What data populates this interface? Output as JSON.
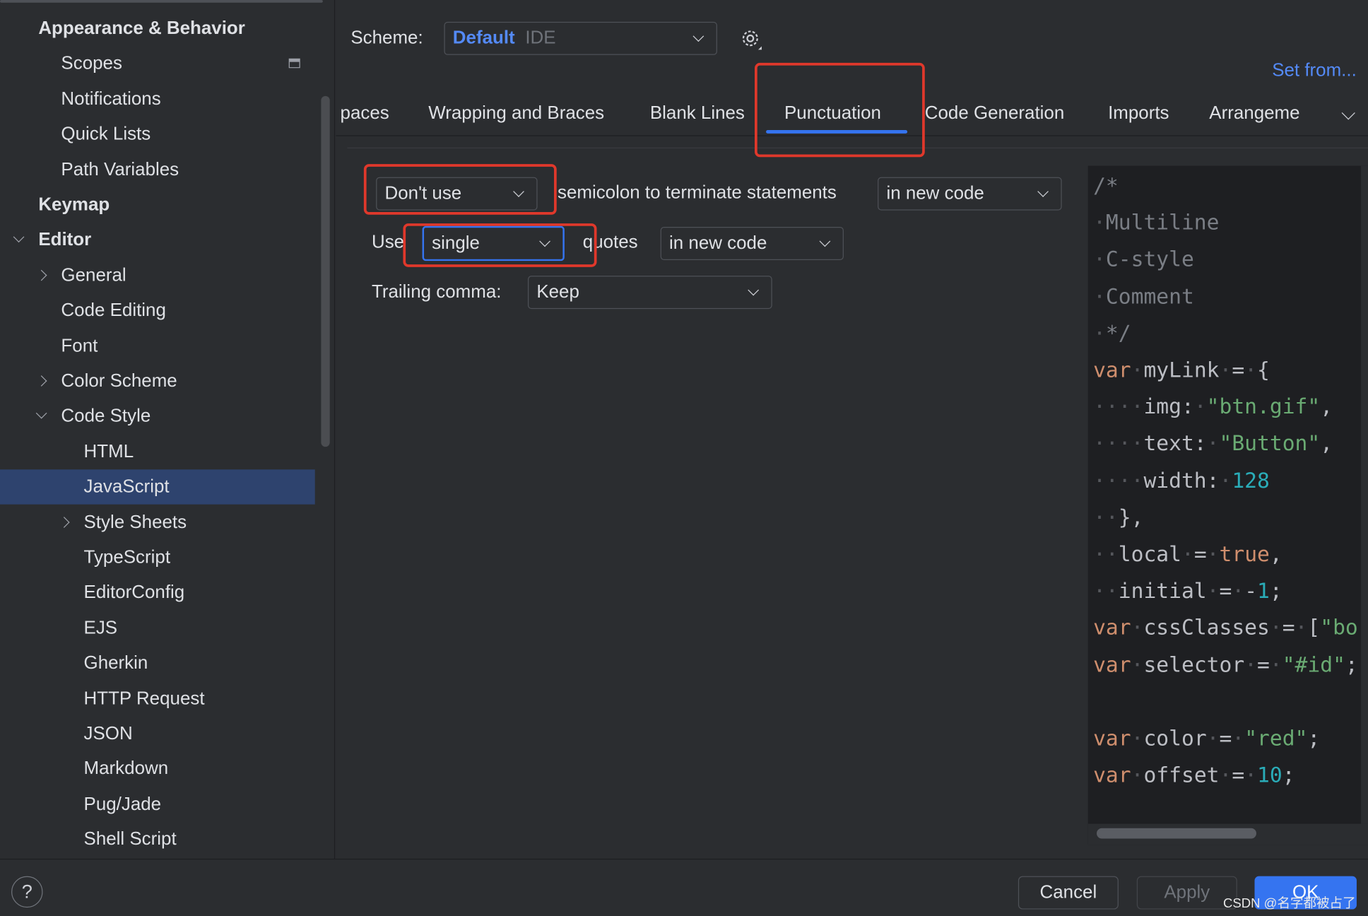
{
  "colors": {
    "accent": "#3574f0",
    "highlight_box": "#e0382b",
    "selection": "#2e436e",
    "link": "#548af7"
  },
  "sidebar": {
    "items": [
      {
        "label": "Appearance & Behavior",
        "level": 0,
        "bold": true
      },
      {
        "label": "Scopes",
        "level": 1,
        "icon": "window-icon"
      },
      {
        "label": "Notifications",
        "level": 1
      },
      {
        "label": "Quick Lists",
        "level": 1
      },
      {
        "label": "Path Variables",
        "level": 1
      },
      {
        "label": "Keymap",
        "level": 0,
        "bold": true
      },
      {
        "label": "Editor",
        "level": 0,
        "bold": true,
        "chevron": "down"
      },
      {
        "label": "General",
        "level": 1,
        "chevron": "right"
      },
      {
        "label": "Code Editing",
        "level": 1
      },
      {
        "label": "Font",
        "level": 1
      },
      {
        "label": "Color Scheme",
        "level": 1,
        "chevron": "right"
      },
      {
        "label": "Code Style",
        "level": 1,
        "chevron": "down"
      },
      {
        "label": "HTML",
        "level": 2
      },
      {
        "label": "JavaScript",
        "level": 2,
        "selected": true
      },
      {
        "label": "Style Sheets",
        "level": 2,
        "chevron": "right"
      },
      {
        "label": "TypeScript",
        "level": 2
      },
      {
        "label": "EditorConfig",
        "level": 2
      },
      {
        "label": "EJS",
        "level": 2
      },
      {
        "label": "Gherkin",
        "level": 2
      },
      {
        "label": "HTTP Request",
        "level": 2
      },
      {
        "label": "JSON",
        "level": 2
      },
      {
        "label": "Markdown",
        "level": 2
      },
      {
        "label": "Pug/Jade",
        "level": 2
      },
      {
        "label": "Shell Script",
        "level": 2
      }
    ]
  },
  "scheme": {
    "label": "Scheme:",
    "name": "Default",
    "type": "IDE",
    "set_from": "Set from..."
  },
  "tabs": [
    {
      "label": "paces"
    },
    {
      "label": "Wrapping and Braces"
    },
    {
      "label": "Blank Lines"
    },
    {
      "label": "Punctuation",
      "active": true
    },
    {
      "label": "Code Generation"
    },
    {
      "label": "Imports"
    },
    {
      "label": "Arrangeme"
    }
  ],
  "settings": {
    "semicolon": {
      "value": "Don't use",
      "text": "semicolon to terminate statements",
      "scope": "in new code"
    },
    "quotes": {
      "prefix": "Use",
      "value": "single",
      "text": "quotes",
      "scope": "in new code"
    },
    "trailing_comma": {
      "label": "Trailing comma:",
      "value": "Keep"
    }
  },
  "preview": {
    "lines": [
      [
        [
          "/*",
          "c"
        ]
      ],
      [
        [
          "·",
          "w"
        ],
        [
          "Multiline",
          "c"
        ]
      ],
      [
        [
          "·",
          "w"
        ],
        [
          "C-style",
          "c"
        ]
      ],
      [
        [
          "·",
          "w"
        ],
        [
          "Comment",
          "c"
        ]
      ],
      [
        [
          "·",
          "w"
        ],
        [
          "*/",
          "c"
        ]
      ],
      [
        [
          "var",
          "k"
        ],
        [
          "·",
          "w"
        ],
        [
          "myLink",
          "p"
        ],
        [
          "·",
          "w"
        ],
        [
          "=",
          "p"
        ],
        [
          "·",
          "w"
        ],
        [
          "{",
          "p"
        ]
      ],
      [
        [
          "····",
          "w"
        ],
        [
          "img:",
          "p"
        ],
        [
          "·",
          "w"
        ],
        [
          "\"btn.gif\"",
          "s"
        ],
        [
          ",",
          "p"
        ]
      ],
      [
        [
          "····",
          "w"
        ],
        [
          "text:",
          "p"
        ],
        [
          "·",
          "w"
        ],
        [
          "\"Button\"",
          "s"
        ],
        [
          ",",
          "p"
        ]
      ],
      [
        [
          "····",
          "w"
        ],
        [
          "width:",
          "p"
        ],
        [
          "·",
          "w"
        ],
        [
          "128",
          "n"
        ]
      ],
      [
        [
          "··",
          "w"
        ],
        [
          "},",
          "p"
        ]
      ],
      [
        [
          "··",
          "w"
        ],
        [
          "local",
          "p"
        ],
        [
          "·",
          "w"
        ],
        [
          "=",
          "p"
        ],
        [
          "·",
          "w"
        ],
        [
          "true",
          "k"
        ],
        [
          ",",
          "p"
        ]
      ],
      [
        [
          "··",
          "w"
        ],
        [
          "initial",
          "p"
        ],
        [
          "·",
          "w"
        ],
        [
          "=",
          "p"
        ],
        [
          "·",
          "w"
        ],
        [
          "-",
          "p"
        ],
        [
          "1",
          "n"
        ],
        [
          ";",
          "p"
        ]
      ],
      [
        [
          "var",
          "k"
        ],
        [
          "·",
          "w"
        ],
        [
          "cssClasses",
          "p"
        ],
        [
          "·",
          "w"
        ],
        [
          "=",
          "p"
        ],
        [
          "·",
          "w"
        ],
        [
          "[",
          "p"
        ],
        [
          "\"bo",
          "s"
        ]
      ],
      [
        [
          "var",
          "k"
        ],
        [
          "·",
          "w"
        ],
        [
          "selector",
          "p"
        ],
        [
          "·",
          "w"
        ],
        [
          "=",
          "p"
        ],
        [
          "·",
          "w"
        ],
        [
          "\"#id\"",
          "s"
        ],
        [
          ";",
          "p"
        ]
      ],
      [],
      [
        [
          "var",
          "k"
        ],
        [
          "·",
          "w"
        ],
        [
          "color",
          "p"
        ],
        [
          "·",
          "w"
        ],
        [
          "=",
          "p"
        ],
        [
          "·",
          "w"
        ],
        [
          "\"red\"",
          "s"
        ],
        [
          ";",
          "p"
        ]
      ],
      [
        [
          "var",
          "k"
        ],
        [
          "·",
          "w"
        ],
        [
          "offset",
          "p"
        ],
        [
          "·",
          "w"
        ],
        [
          "=",
          "p"
        ],
        [
          "·",
          "w"
        ],
        [
          "10",
          "n"
        ],
        [
          ";",
          "p"
        ]
      ]
    ]
  },
  "footer": {
    "help": "?",
    "cancel": "Cancel",
    "apply": "Apply",
    "ok": "OK",
    "watermark": "CSDN @名字都被占了"
  }
}
